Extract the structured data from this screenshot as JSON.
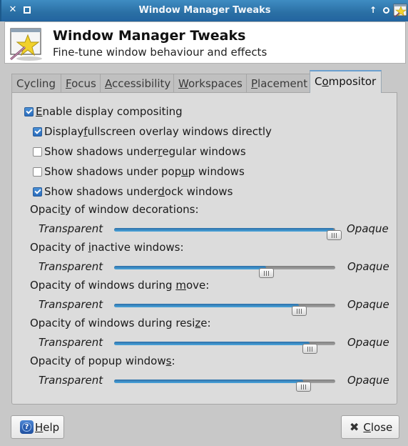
{
  "window": {
    "title": "Window Manager Tweaks",
    "controls": {
      "close_glyph": "✕",
      "up_glyph": "↑"
    }
  },
  "header": {
    "title": "Window Manager Tweaks",
    "subtitle": "Fine-tune window behaviour and effects",
    "icon": "wm-tweaks-star-icon"
  },
  "tabs": [
    {
      "label": "Cycling",
      "mnemonic": "",
      "active": false
    },
    {
      "label": "Focus",
      "mnemonic": "F",
      "active": false
    },
    {
      "label": "Accessibility",
      "mnemonic": "A",
      "active": false
    },
    {
      "label": "Workspaces",
      "mnemonic": "W",
      "active": false
    },
    {
      "label": "Placement",
      "mnemonic": "P",
      "active": false
    },
    {
      "label": "Compositor",
      "mnemonic": "o",
      "active": true
    }
  ],
  "tab_parts": {
    "cycling": {
      "pre": "Cycling",
      "u": "",
      "post": ""
    },
    "focus": {
      "pre": "",
      "u": "F",
      "post": "ocus"
    },
    "accessibility": {
      "pre": "",
      "u": "A",
      "post": "ccessibility"
    },
    "workspaces": {
      "pre": "",
      "u": "W",
      "post": "orkspaces"
    },
    "placement": {
      "pre": "",
      "u": "P",
      "post": "lacement"
    },
    "compositor": {
      "pre": "C",
      "u": "o",
      "post": "mpositor"
    }
  },
  "checkboxes": [
    {
      "pre": "",
      "u": "E",
      "post": "nable display compositing",
      "checked": true
    },
    {
      "pre": "Display ",
      "u": "f",
      "post": "ullscreen overlay windows directly",
      "checked": true
    },
    {
      "pre": "Show shadows under ",
      "u": "r",
      "post": "egular windows",
      "checked": false
    },
    {
      "pre": "Show shadows under pop",
      "u": "u",
      "post": "p windows",
      "checked": false
    },
    {
      "pre": "Show shadows under ",
      "u": "d",
      "post": "ock windows",
      "checked": true
    }
  ],
  "sliders": [
    {
      "label_pre": "Opaci",
      "label_u": "t",
      "label_post": "y of window decorations:",
      "min_label": "Transparent",
      "max_label": "Opaque",
      "value_percent": 100
    },
    {
      "label_pre": "Opacity of ",
      "label_u": "i",
      "label_post": "nactive windows:",
      "min_label": "Transparent",
      "max_label": "Opaque",
      "value_percent": 70
    },
    {
      "label_pre": "Opacity of windows during ",
      "label_u": "m",
      "label_post": "ove:",
      "min_label": "Transparent",
      "max_label": "Opaque",
      "value_percent": 86
    },
    {
      "label_pre": "Opacity of windows during resi",
      "label_u": "z",
      "label_post": "e:",
      "min_label": "Transparent",
      "max_label": "Opaque",
      "value_percent": 91
    },
    {
      "label_pre": "Opacity of popup window",
      "label_u": "s",
      "label_post": ":",
      "min_label": "Transparent",
      "max_label": "Opaque",
      "value_percent": 88
    }
  ],
  "buttons": {
    "help": {
      "pre": "",
      "u": "H",
      "post": "elp",
      "icon_glyph": "?"
    },
    "close": {
      "pre": "",
      "u": "C",
      "post": "lose",
      "icon_glyph": "✖"
    }
  },
  "colors": {
    "titlebar": "#2a6fa4",
    "slider_fill": "#3a8cc8",
    "checkbox_checked": "#2a6cbc"
  }
}
